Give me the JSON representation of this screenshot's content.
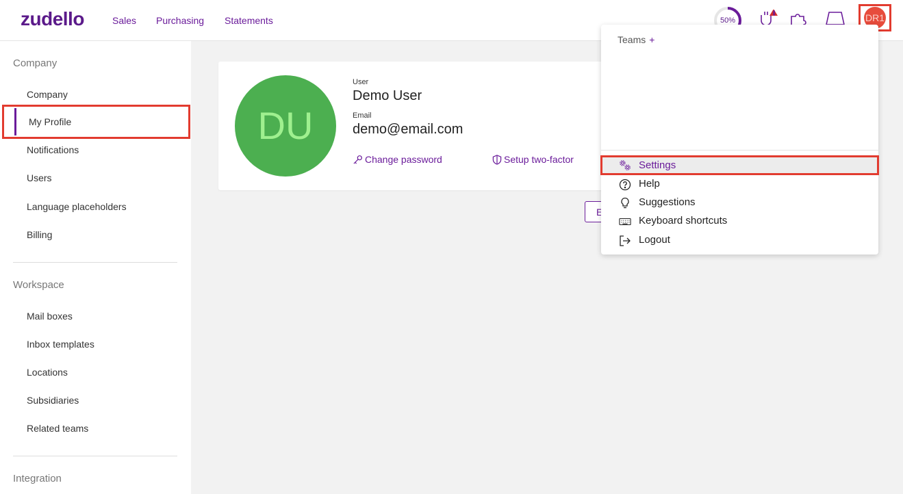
{
  "brand": {
    "logo_text": "zudello"
  },
  "nav": {
    "sales": "Sales",
    "purchasing": "Purchasing",
    "statements": "Statements"
  },
  "toolbar": {
    "progress_label": "50%",
    "progress_fraction": 0.5,
    "avatar_initials": "DR1"
  },
  "sidebar": {
    "company_section": "Company",
    "company_items": [
      "Company",
      "My Profile",
      "Notifications",
      "Users",
      "Language placeholders",
      "Billing"
    ],
    "workspace_section": "Workspace",
    "workspace_items": [
      "Mail boxes",
      "Inbox templates",
      "Locations",
      "Subsidiaries",
      "Related teams"
    ],
    "integration_section": "Integration"
  },
  "profile": {
    "avatar_initials": "DU",
    "user_label": "User",
    "user_name": "Demo User",
    "email_label": "Email",
    "email": "demo@email.com",
    "change_password": "Change password",
    "setup_two_factor": "Setup two-factor",
    "edit_partial": "E"
  },
  "dropdown": {
    "teams_label": "Teams",
    "teams_add": "+",
    "items": [
      "Settings",
      "Help",
      "Suggestions",
      "Keyboard shortcuts",
      "Logout"
    ]
  },
  "colors": {
    "accent": "#6a1b9a",
    "highlight": "#e23b2f",
    "avatar_green": "#4caf50",
    "avatar_red": "#e74c3c"
  }
}
